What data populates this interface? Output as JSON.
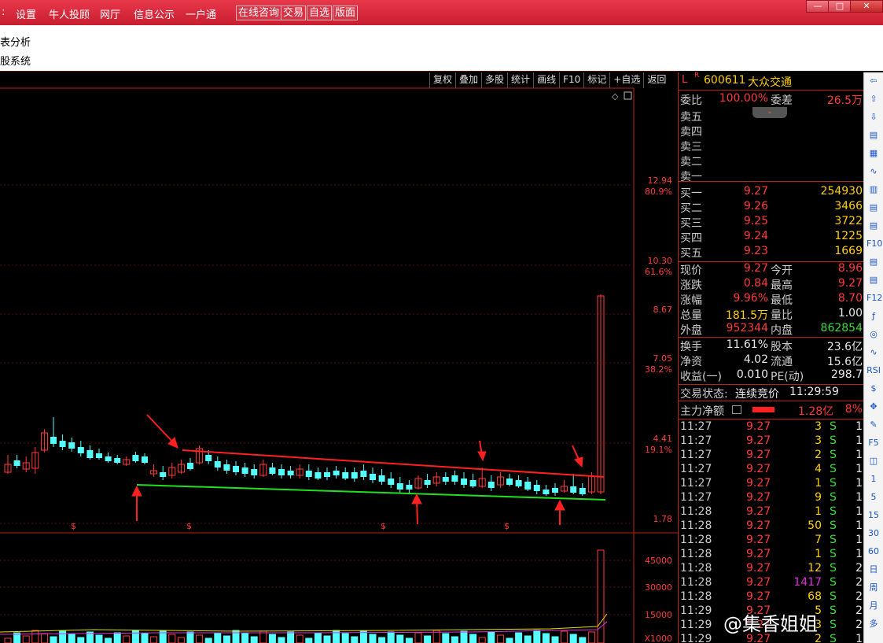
{
  "titlebar": {
    "menu": [
      "设置",
      "牛人投顾",
      "网厅",
      "信息公示",
      "一户通"
    ],
    "buttons": [
      "在线咨询",
      "交易",
      "自选",
      "版面"
    ],
    "win_min": "—",
    "win_max": "□",
    "win_close": "✕"
  },
  "subbar": {
    "line1": "表分析",
    "line2": "股系统"
  },
  "toolbar": [
    "复权",
    "叠加",
    "多股",
    "统计",
    "画线",
    "F10",
    "标记",
    "+自选",
    "返回"
  ],
  "price_axis": [
    {
      "v": "12.94",
      "p": "80.9%"
    },
    {
      "v": "10.30",
      "p": "61.6%"
    },
    {
      "v": "8.67",
      "p": ""
    },
    {
      "v": "7.05",
      "p": "38.2%"
    },
    {
      "v": "4.41",
      "p": "19.1%"
    },
    {
      "v": "1.78",
      "p": ""
    }
  ],
  "vol_axis": [
    "45000",
    "30000",
    "15000",
    "X1000"
  ],
  "stock": {
    "marker_l": "L",
    "marker_r": "R",
    "code": "600611",
    "name": "大众交通"
  },
  "weibi": {
    "label": "委比",
    "value": "100.00%",
    "label2": "委差",
    "value2": "26.5万"
  },
  "asks": [
    "卖五",
    "卖四",
    "卖三",
    "卖二",
    "卖一"
  ],
  "bids": [
    {
      "label": "买一",
      "price": "9.27",
      "vol": "254930"
    },
    {
      "label": "买二",
      "price": "9.26",
      "vol": "3466"
    },
    {
      "label": "买三",
      "price": "9.25",
      "vol": "3722"
    },
    {
      "label": "买四",
      "price": "9.24",
      "vol": "1225"
    },
    {
      "label": "买五",
      "price": "9.23",
      "vol": "1669"
    }
  ],
  "quote": [
    {
      "l1": "现价",
      "v1": "9.27",
      "c1": "red",
      "l2": "今开",
      "v2": "8.96",
      "c2": "red"
    },
    {
      "l1": "涨跌",
      "v1": "0.84",
      "c1": "red",
      "l2": "最高",
      "v2": "9.27",
      "c2": "red"
    },
    {
      "l1": "涨幅",
      "v1": "9.96%",
      "c1": "red",
      "l2": "最低",
      "v2": "8.70",
      "c2": "red"
    },
    {
      "l1": "总量",
      "v1": "181.5万",
      "c1": "yellow",
      "l2": "量比",
      "v2": "1.00",
      "c2": "white"
    },
    {
      "l1": "外盘",
      "v1": "952344",
      "c1": "red",
      "l2": "内盘",
      "v2": "862854",
      "c2": "green"
    }
  ],
  "fundamentals": [
    {
      "l1": "换手",
      "v1": "11.61%",
      "l2": "股本",
      "v2": "23.6亿"
    },
    {
      "l1": "净资",
      "v1": "4.02",
      "l2": "流通",
      "v2": "15.6亿"
    },
    {
      "l1": "收益(一)",
      "v1": "0.010",
      "l2": "PE(动)",
      "v2": "298.7"
    }
  ],
  "status": {
    "label": "交易状态:",
    "value": "连续竞价",
    "time": "11:29:59"
  },
  "main_flow": {
    "label": "主力净额",
    "value": "1.28亿",
    "pct": "8%"
  },
  "ticks": [
    {
      "t": "11:27",
      "p": "9.27",
      "v": "3",
      "s": "S",
      "n": "1",
      "vc": "yellow"
    },
    {
      "t": "11:27",
      "p": "9.27",
      "v": "3",
      "s": "S",
      "n": "1",
      "vc": "yellow"
    },
    {
      "t": "11:27",
      "p": "9.27",
      "v": "2",
      "s": "S",
      "n": "1",
      "vc": "yellow"
    },
    {
      "t": "11:27",
      "p": "9.27",
      "v": "4",
      "s": "S",
      "n": "1",
      "vc": "yellow"
    },
    {
      "t": "11:27",
      "p": "9.27",
      "v": "1",
      "s": "S",
      "n": "1",
      "vc": "yellow"
    },
    {
      "t": "11:27",
      "p": "9.27",
      "v": "9",
      "s": "S",
      "n": "1",
      "vc": "yellow"
    },
    {
      "t": "11:28",
      "p": "9.27",
      "v": "1",
      "s": "S",
      "n": "1",
      "vc": "yellow"
    },
    {
      "t": "11:28",
      "p": "9.27",
      "v": "50",
      "s": "S",
      "n": "1",
      "vc": "yellow"
    },
    {
      "t": "11:28",
      "p": "9.27",
      "v": "7",
      "s": "S",
      "n": "1",
      "vc": "yellow"
    },
    {
      "t": "11:28",
      "p": "9.27",
      "v": "1",
      "s": "S",
      "n": "1",
      "vc": "yellow"
    },
    {
      "t": "11:28",
      "p": "9.27",
      "v": "12",
      "s": "S",
      "n": "2",
      "vc": "yellow"
    },
    {
      "t": "11:28",
      "p": "9.27",
      "v": "1417",
      "s": "S",
      "n": "2",
      "vc": "magenta"
    },
    {
      "t": "11:28",
      "p": "9.27",
      "v": "68",
      "s": "S",
      "n": "2",
      "vc": "yellow"
    },
    {
      "t": "11:29",
      "p": "9.27",
      "v": "5",
      "s": "S",
      "n": "2",
      "vc": "yellow"
    },
    {
      "t": "11:29",
      "p": "9.27",
      "v": "3",
      "s": "S",
      "n": "2",
      "vc": "yellow"
    },
    {
      "t": "11:29",
      "p": "9.27",
      "v": "2",
      "s": "S",
      "n": "1",
      "vc": "yellow"
    }
  ],
  "strip": [
    "⇦",
    "⇧",
    "⇩",
    "▤",
    "▦",
    "∿",
    "▥",
    "▤",
    "▤",
    "F10",
    "▤",
    "▤",
    "F12",
    "ƒ",
    "◎",
    "∿",
    "RSI",
    "$",
    "✥",
    "✎",
    "F5",
    "◫",
    "1",
    "5",
    "15",
    "30",
    "60",
    "日",
    "周",
    "月",
    "多"
  ],
  "watermark": "@集香姐姐",
  "colors": {
    "up": "#ff3b3b",
    "down": "#5ff",
    "resistance": "#ff2020",
    "support": "#20e020"
  }
}
